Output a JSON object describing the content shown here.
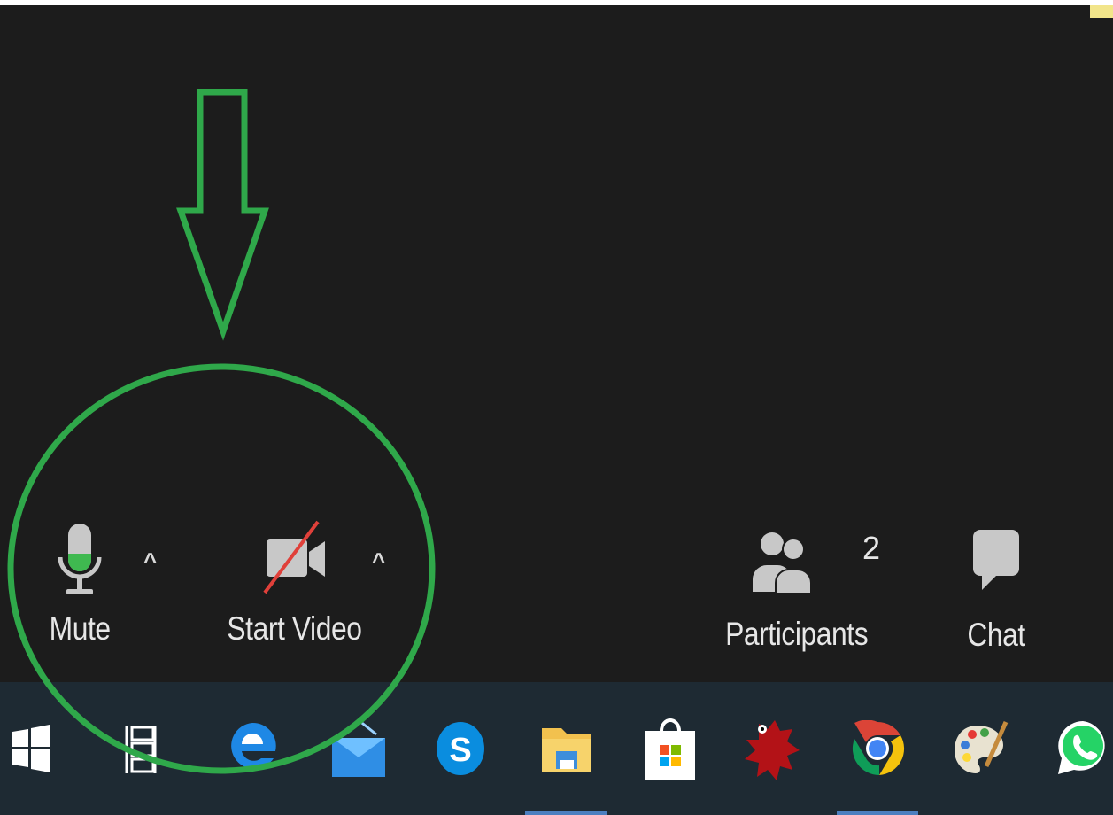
{
  "meeting_controls": {
    "mute_label": "Mute",
    "start_video_label": "Start Video",
    "participants_label": "Participants",
    "participants_count": "2",
    "chat_label": "Chat",
    "caret_glyph": "^"
  },
  "taskbar": {
    "items": [
      {
        "name": "start-button",
        "icon": "windows-icon"
      },
      {
        "name": "task-view-button",
        "icon": "task-view-icon"
      },
      {
        "name": "edge-app",
        "icon": "edge-icon"
      },
      {
        "name": "mail-app",
        "icon": "mail-icon"
      },
      {
        "name": "skype-app",
        "icon": "skype-icon",
        "letter": "S"
      },
      {
        "name": "file-explorer-app",
        "icon": "folder-icon",
        "active": true
      },
      {
        "name": "store-app",
        "icon": "store-icon"
      },
      {
        "name": "red-app",
        "icon": "red-creature-icon"
      },
      {
        "name": "chrome-app",
        "icon": "chrome-icon",
        "active": true
      },
      {
        "name": "paint-app",
        "icon": "palette-icon"
      },
      {
        "name": "whatsapp-app",
        "icon": "whatsapp-icon"
      }
    ]
  },
  "colors": {
    "meeting_bg": "#1c1c1c",
    "taskbar_bg": "#1e2a33",
    "annotation_green": "#2fa84a",
    "icon_gray": "#c8c8c8",
    "mic_level_green": "#3fb950",
    "video_off_red": "#e0403a"
  }
}
